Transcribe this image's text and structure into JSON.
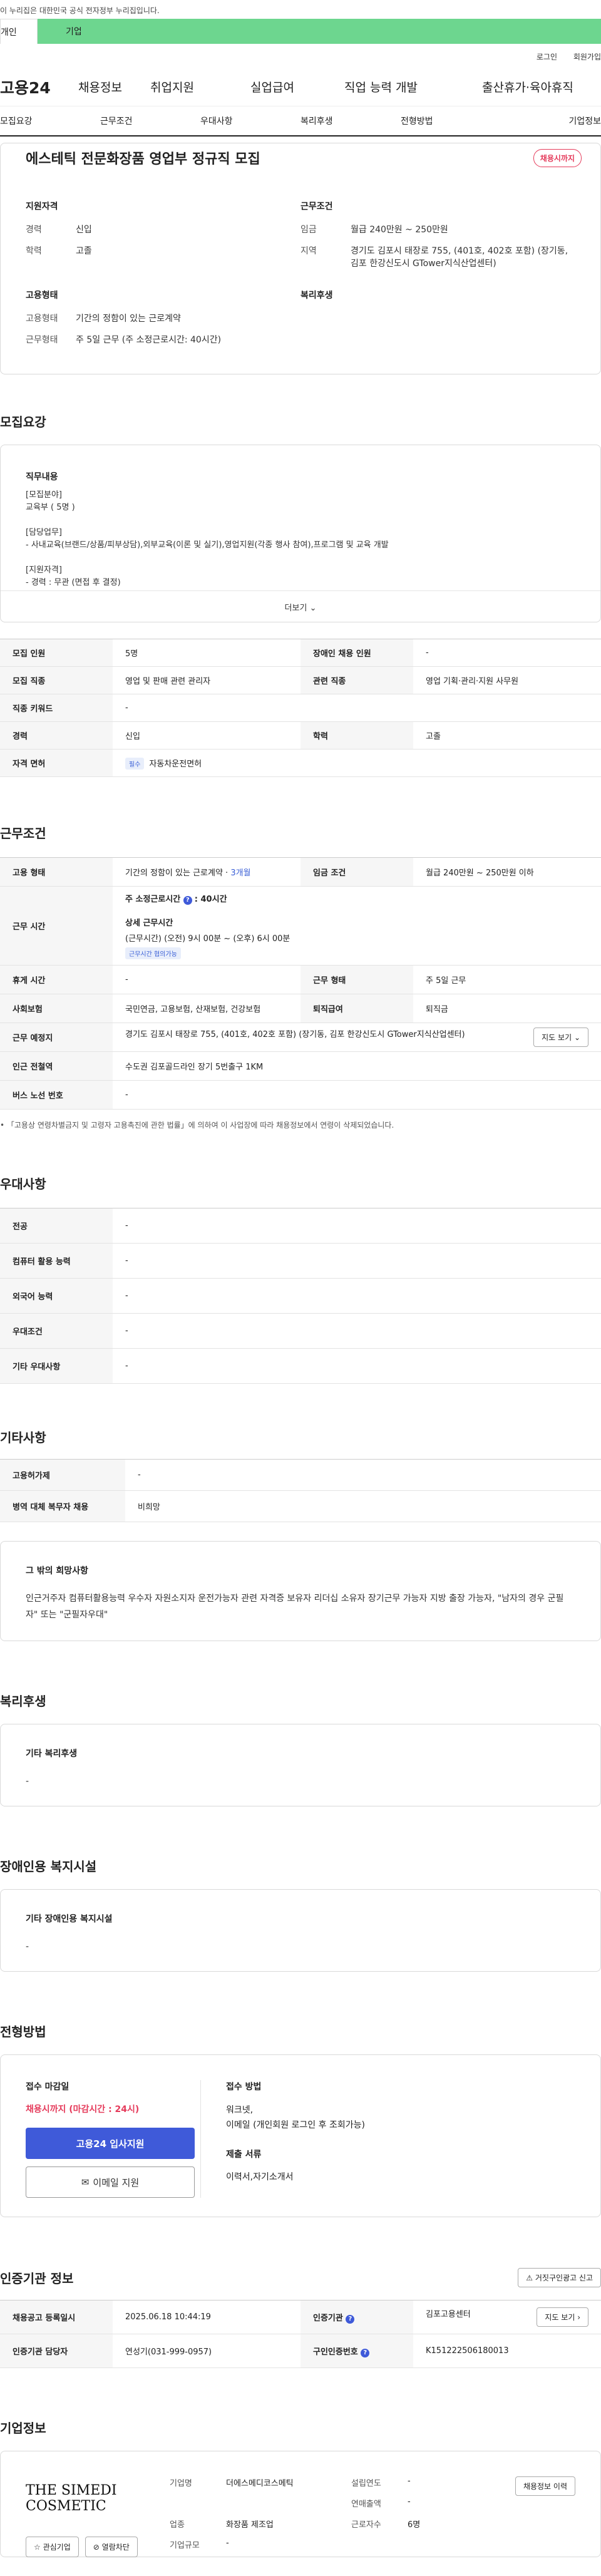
{
  "gov_banner": "이 누리집은 대한민국 공식 전자정부 누리집입니다.",
  "user_tabs": [
    "개인",
    "기업"
  ],
  "util": [
    "로그인",
    "회원가입"
  ],
  "gnb": {
    "logo": "고용24",
    "menu": [
      "채용정보",
      "취업지원",
      "실업급여",
      "직업 능력 개발",
      "출산휴가·육아휴직"
    ]
  },
  "subnav": [
    "모집요강",
    "근무조건",
    "우대사항",
    "복리후생",
    "전형방법",
    "기업정보"
  ],
  "job": {
    "title": "에스테틱 전문화장품 영업부 정규직 모집",
    "status": "채용시까지",
    "summary_left_title": "지원자격",
    "summary_right_title": "근무조건",
    "career_label": "경력",
    "career": "신입",
    "edu_label": "학력",
    "edu": "고졸",
    "wage_label": "임금",
    "wage": "월급 240만원 ~ 250만원",
    "region_label": "지역",
    "region": "경기도 김포시 태장로 755, (401호, 402호 포함) (장기동, 김포 한강신도시 GTower지식산업센터)",
    "emp_title": "고용형태",
    "benefit_title": "복리후생",
    "emp_type_label": "고용형태",
    "emp_type": "기간의 정함이 있는 근로계약",
    "work_form_label": "근무형태",
    "work_form": "주 5일 근무 (주 소정근로시간: 40시간)"
  },
  "recruit": {
    "heading": "모집요강",
    "detail_title": "직무내용",
    "detail_lines": [
      "[모집분야]",
      "교육부 ( 5명 )",
      "",
      "[담당업무]",
      "- 사내교육(브랜드/상품/피부상담),외부교육(이론 및 실기),영업지원(각종 행사 참여),프로그램 및 교육 개발",
      "",
      "[지원자격]",
      "- 경력 : 무관 (면접 후 결정)"
    ],
    "more_label": "더보기",
    "rows": [
      [
        "모집 인원",
        "5명",
        "장애인 채용 인원",
        "-"
      ],
      [
        "모집 직종",
        "영업 및 판매 관련 관리자",
        "관련 직종",
        "영업 기획·관리·지원 사무원"
      ],
      [
        "직종 키워드",
        "-"
      ],
      [
        "경력",
        "신입",
        "학력",
        "고졸"
      ],
      [
        "자격 면허",
        "자동차운전면허"
      ]
    ],
    "license_tag": "필수"
  },
  "cond": {
    "heading": "근무조건",
    "emp_label": "고용 형태",
    "emp": "기간의 정함이 있는 근로계약 · ",
    "emp_months": "3개월",
    "wage_label": "임금 조건",
    "wage": "월급 240만원 ~ 250만원 이하",
    "time_label": "근무 시간",
    "week_hours": "주 소정근로시간 ",
    "week_hours_val": "40시간",
    "detail_time_title": "상세 근무시간",
    "detail_time": "(근무시간) (오전) 9시 00분 ~ (오후) 6시 00분",
    "flex_tag": "근무시간 협의가능",
    "rest_label": "휴게 시간",
    "rest": "-",
    "form_label": "근무 형태",
    "form": "주 5일 근무",
    "ins_label": "사회보험",
    "ins": "국민연금, 고용보험, 산재보험, 건강보험",
    "sev_label": "퇴직급여",
    "sev": "퇴직금",
    "place_label": "근무 예정지",
    "place": "경기도 김포시 태장로 755, (401호, 402호 포함) (장기동, 김포 한강신도시 GTower지식산업센터)",
    "map_btn": "지도 보기",
    "subway_label": "인근 전철역",
    "subway": "수도권 김포골드라인 장기 5번출구 1KM",
    "bus_label": "버스 노선 번호",
    "bus": "-",
    "note": "• 「고용상 연령차별금지 및 고령자 고용촉진에 관한 법률」에 의하여 이 사업장에 따라 채용정보에서 연령이 삭제되었습니다."
  },
  "pref": {
    "heading": "우대사항",
    "rows": [
      [
        "전공",
        "-"
      ],
      [
        "컴퓨터 활용 능력",
        "-"
      ],
      [
        "외국어 능력",
        "-"
      ],
      [
        "우대조건",
        "-"
      ],
      [
        "기타 우대사항",
        "-"
      ]
    ]
  },
  "etc": {
    "heading": "기타사항",
    "rows": [
      [
        "고용허가제",
        "-"
      ],
      [
        "병역 대체 복무자 채용",
        "비희망"
      ]
    ],
    "other_title": "그 밖의 희망사항",
    "other_text": "인근거주자  컴퓨터활용능력 우수자  자원소지자  운전가능자  관련 자격증 보유자  리더십 소유자  장기근무 가능자  지방 출장 가능자, \"남자의 경우 군필자\" 또는 \"군필자우대\""
  },
  "welfare": {
    "heading": "복리후생",
    "title": "기타 복리후생",
    "value": "-"
  },
  "disabled": {
    "heading": "장애인용 복지시설",
    "title": "기타 장애인용 복지시설",
    "value": "-"
  },
  "select": {
    "heading": "전형방법",
    "deadline_title": "접수 마감일",
    "deadline": "채용시까지 (마감시간 : 24시)",
    "apply_btn": "고용24 입사지원",
    "email_btn": "이메일 지원",
    "method_title": "접수 방법",
    "method": "워크넷,\n이메일 (개인회원 로그인 후 조회가능)",
    "docs_title": "제출 서류",
    "docs": "이력서,자기소개서"
  },
  "cert": {
    "heading": "인증기관 정보",
    "report_btn": "거짓구인광고 신고",
    "reg_label": "채용공고 등록일시",
    "reg": "2025.06.18 10:44:19",
    "org_label": "인증기관",
    "org": "김포고용센터",
    "map_btn": "지도 보기",
    "mgr_label": "인증기관 담당자",
    "mgr": "연성기(031-999-0957)",
    "cert_no_label": "구인인증번호",
    "cert_no": "K151222506180013"
  },
  "company": {
    "heading": "기업정보",
    "logo_text": "THE SIMEDI COSMETIC",
    "fav_btn": "관심기업",
    "block_btn": "열람차단",
    "name_label": "기업명",
    "name": "더에스메디코스메틱",
    "founded_label": "설립연도",
    "founded": "-",
    "sales_label": "연매출액",
    "sales": "-",
    "industry_label": "업종",
    "industry": "화장품 제조업",
    "staff_label": "근로자수",
    "staff": "6명",
    "size_label": "기업규모",
    "size": "-",
    "history_btn": "채용정보 이력"
  }
}
